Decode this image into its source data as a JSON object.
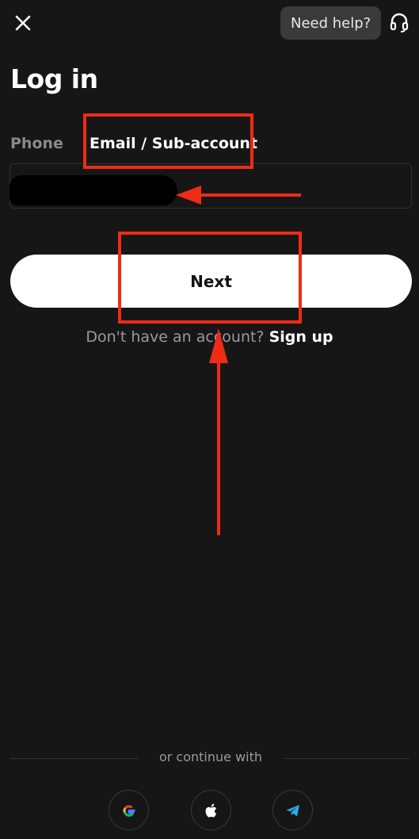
{
  "header": {
    "help_label": "Need help?"
  },
  "page": {
    "title": "Log in"
  },
  "tabs": [
    {
      "label": "Phone",
      "active": false
    },
    {
      "label": "Email / Sub-account",
      "active": true
    }
  ],
  "form": {
    "email_value": "",
    "next_label": "Next"
  },
  "signup": {
    "prompt": "Don't have an account?",
    "link": "Sign up"
  },
  "social": {
    "divider_text": "or continue with",
    "providers": [
      "google-icon",
      "apple-icon",
      "telegram-icon"
    ]
  },
  "colors": {
    "background": "#161616",
    "annotation": "#ef2b17",
    "button": "#ffffff"
  }
}
